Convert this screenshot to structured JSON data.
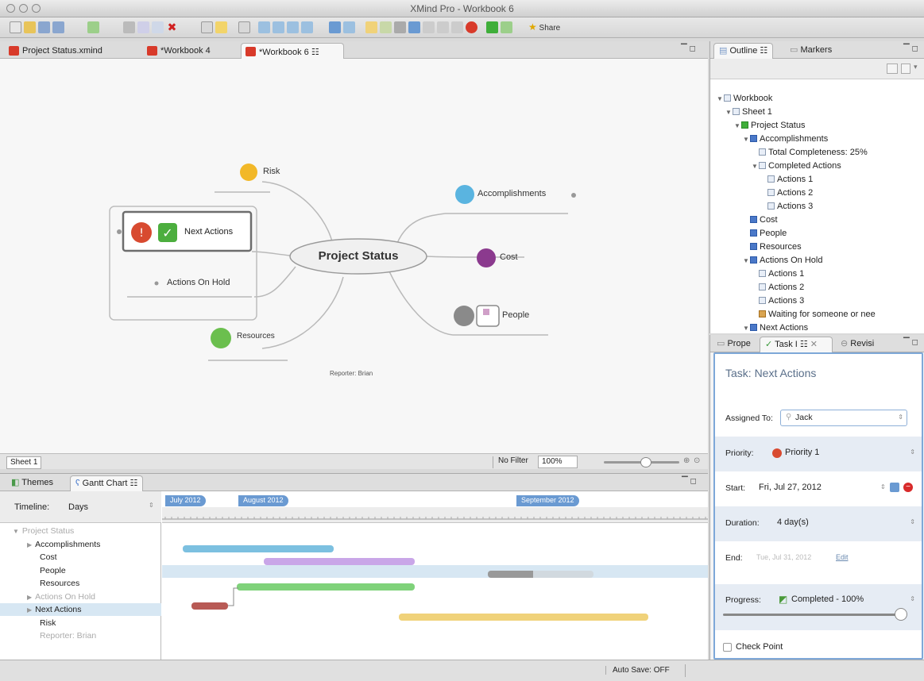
{
  "window": {
    "title": "XMind Pro - Workbook 6"
  },
  "editor": {
    "tabs": [
      {
        "label": "Project Status.xmind"
      },
      {
        "label": "*Workbook 4"
      },
      {
        "label": "*Workbook 6 ☷"
      }
    ],
    "map": {
      "central": "Project Status",
      "topics": {
        "risk": "Risk",
        "accomplishments": "Accomplishments",
        "next_actions": "Next Actions",
        "actions_on_hold": "Actions On Hold",
        "cost": "Cost",
        "people": "People",
        "resources": "Resources"
      },
      "reporter": "Reporter: Brian"
    },
    "sheet_tab": "Sheet 1",
    "filter": "No Filter",
    "zoom": "100%"
  },
  "gantt": {
    "tabs": {
      "themes": "Themes",
      "gantt": "Gantt Chart ☷"
    },
    "timeline_label": "Timeline:",
    "timeline_unit": "Days",
    "months": [
      "July 2012",
      "August 2012",
      "September 2012"
    ],
    "items": [
      {
        "label": "Project Status",
        "muted": true,
        "indent": 0
      },
      {
        "label": "Accomplishments",
        "muted": false,
        "indent": 1
      },
      {
        "label": "Cost",
        "muted": false,
        "indent": 2
      },
      {
        "label": "People",
        "muted": false,
        "indent": 2
      },
      {
        "label": "Resources",
        "muted": false,
        "indent": 2
      },
      {
        "label": "Actions On Hold",
        "muted": true,
        "indent": 1
      },
      {
        "label": "Next Actions",
        "muted": false,
        "indent": 1,
        "selected": true
      },
      {
        "label": "Risk",
        "muted": false,
        "indent": 2
      },
      {
        "label": "Reporter: Brian",
        "muted": true,
        "indent": 2
      }
    ],
    "bar_colors": {
      "accomplishments": "#7cc0e0",
      "cost": "#c9a6e8",
      "people": "#aaaaaa",
      "resources": "#7fd27a",
      "next_actions": "#b85a55",
      "risk": "#f0d27a"
    }
  },
  "outline": {
    "tabs": {
      "outline": "Outline ☷",
      "markers": "Markers"
    },
    "tree": [
      {
        "label": "Workbook",
        "level": 0,
        "icon": "file",
        "twisty": "▼"
      },
      {
        "label": "Sheet 1",
        "level": 1,
        "icon": "file",
        "twisty": "▼"
      },
      {
        "label": "Project Status",
        "level": 2,
        "icon": "gr",
        "twisty": "▼"
      },
      {
        "label": "Accomplishments",
        "level": 3,
        "icon": "sq",
        "twisty": "▼"
      },
      {
        "label": "Total Completeness: 25%",
        "level": 4,
        "icon": "file",
        "twisty": ""
      },
      {
        "label": "Completed Actions",
        "level": 4,
        "icon": "file",
        "twisty": "▼"
      },
      {
        "label": "Actions 1",
        "level": 5,
        "icon": "file",
        "twisty": ""
      },
      {
        "label": "Actions 2",
        "level": 5,
        "icon": "file",
        "twisty": ""
      },
      {
        "label": "Actions 3",
        "level": 5,
        "icon": "file",
        "twisty": ""
      },
      {
        "label": "Cost",
        "level": 3,
        "icon": "sq",
        "twisty": ""
      },
      {
        "label": "People",
        "level": 3,
        "icon": "sq",
        "twisty": ""
      },
      {
        "label": "Resources",
        "level": 3,
        "icon": "sq",
        "twisty": ""
      },
      {
        "label": "Actions On Hold",
        "level": 3,
        "icon": "sq",
        "twisty": "▼"
      },
      {
        "label": "Actions 1",
        "level": 4,
        "icon": "file",
        "twisty": ""
      },
      {
        "label": "Actions 2",
        "level": 4,
        "icon": "file",
        "twisty": ""
      },
      {
        "label": "Actions 3",
        "level": 4,
        "icon": "file",
        "twisty": ""
      },
      {
        "label": "Waiting for someone or nee",
        "level": 4,
        "icon": "pr",
        "twisty": ""
      },
      {
        "label": "Next Actions",
        "level": 3,
        "icon": "sq",
        "twisty": "▼"
      }
    ]
  },
  "task": {
    "tabs": {
      "prope": "Prope",
      "task": "Task I ☷",
      "revisi": "Revisi"
    },
    "title": "Task: Next Actions",
    "assigned_label": "Assigned To:",
    "assigned_value": "Jack",
    "priority_label": "Priority:",
    "priority_value": "Priority 1",
    "start_label": "Start:",
    "start_value": "Fri, Jul 27, 2012",
    "duration_label": "Duration:",
    "duration_value": "4 day(s)",
    "end_label": "End:",
    "end_value": "Tue, Jul 31, 2012",
    "end_link": "Edit",
    "progress_label": "Progress:",
    "progress_value": "Completed - 100%",
    "progress_fraction": 1.0,
    "checkpoint_label": "Check Point"
  },
  "status": {
    "autosave": "Auto Save: OFF"
  }
}
